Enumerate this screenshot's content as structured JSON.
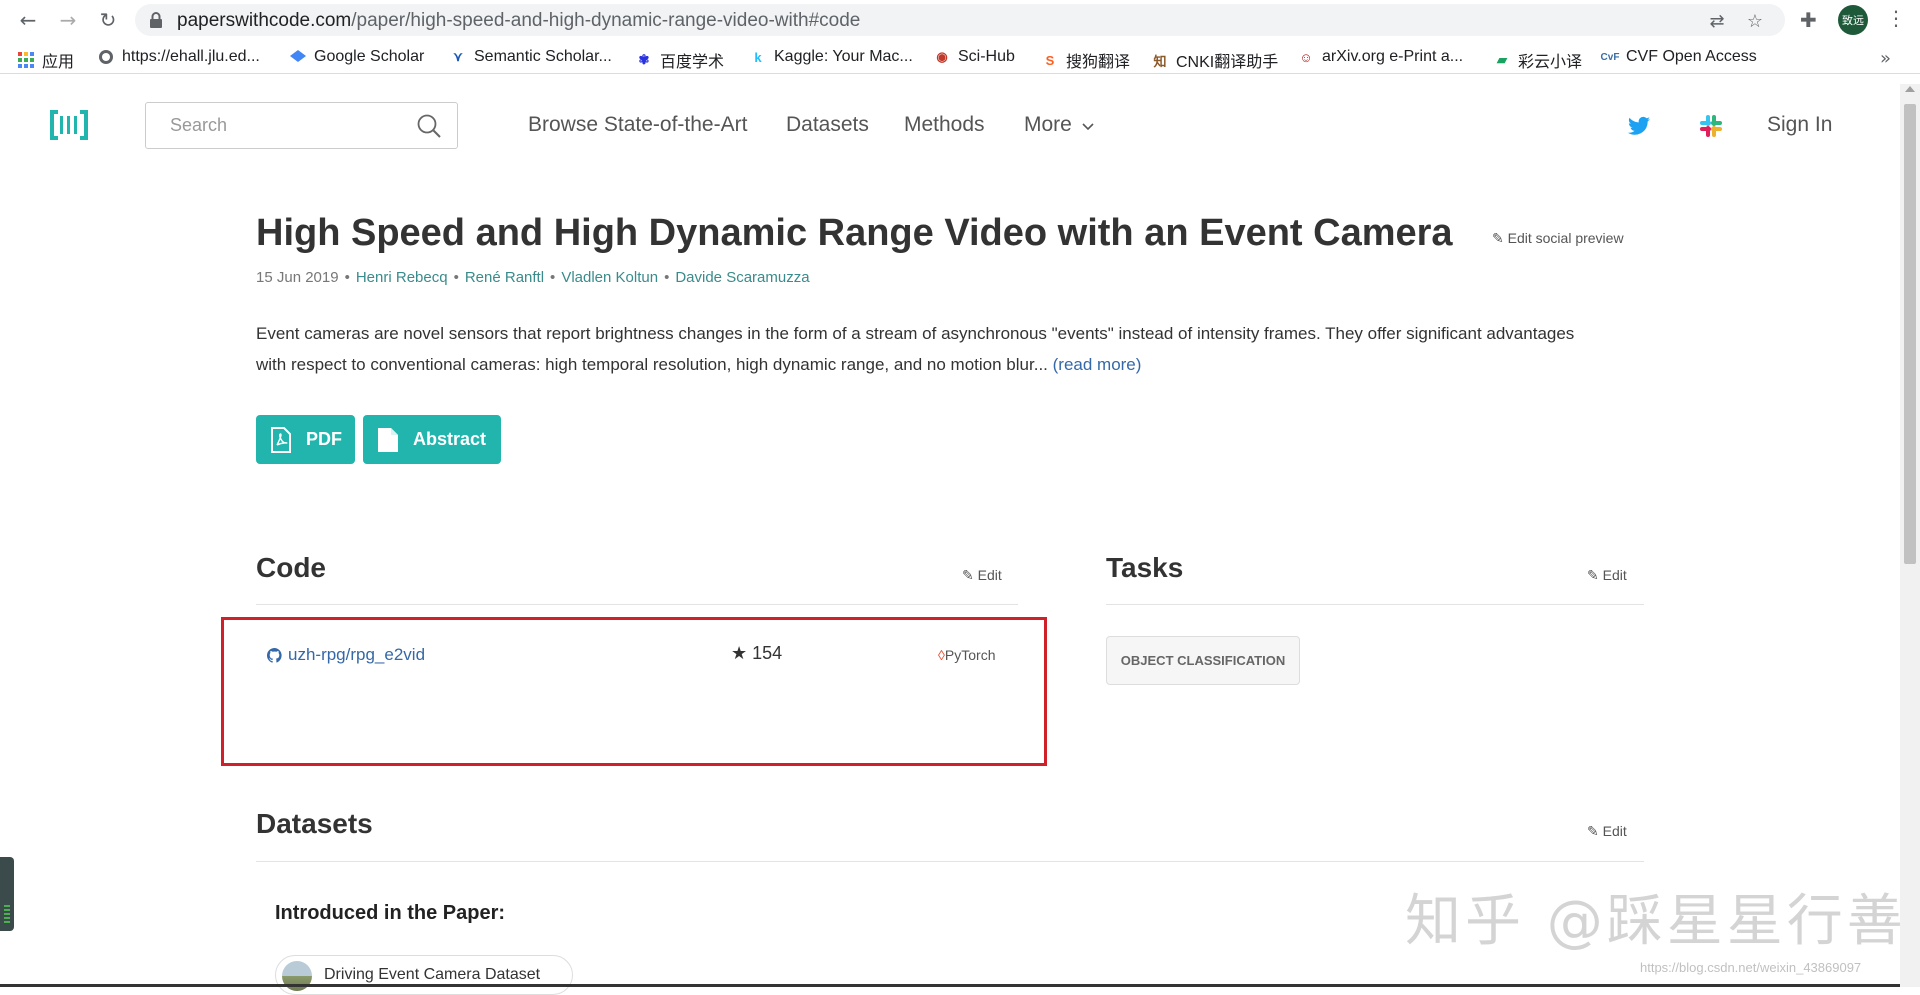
{
  "browser": {
    "url_host": "paperswithcode.com",
    "url_path": "/paper/high-speed-and-high-dynamic-range-video-with#code",
    "profile_label": "致远",
    "bookmarks": [
      {
        "label": "应用",
        "icon": "apps-grid-icon"
      },
      {
        "label": "https://ehall.jlu.ed...",
        "icon": "globe-icon"
      },
      {
        "label": "Google Scholar",
        "icon": "google-scholar-icon"
      },
      {
        "label": "Semantic Scholar...",
        "icon": "semantic-scholar-icon"
      },
      {
        "label": "百度学术",
        "icon": "baidu-icon"
      },
      {
        "label": "Kaggle: Your Mac...",
        "icon": "kaggle-icon"
      },
      {
        "label": "Sci-Hub",
        "icon": "scihub-icon"
      },
      {
        "label": "搜狗翻译",
        "icon": "sogou-icon"
      },
      {
        "label": "CNKI翻译助手",
        "icon": "cnki-icon"
      },
      {
        "label": "arXiv.org e-Print a...",
        "icon": "arxiv-icon"
      },
      {
        "label": "彩云小译",
        "icon": "caiyun-icon"
      },
      {
        "label": "CVF Open Access",
        "icon": "cvf-icon"
      }
    ],
    "more_bookmarks": "»"
  },
  "site": {
    "search_placeholder": "Search",
    "nav": [
      "Browse State-of-the-Art",
      "Datasets",
      "Methods",
      "More"
    ],
    "sign_in": "Sign In",
    "brand_color": "#21b5ad"
  },
  "paper": {
    "title": "High Speed and High Dynamic Range Video with an Event Camera",
    "edit_social": "Edit social preview",
    "date": "15 Jun 2019",
    "authors": [
      "Henri Rebecq",
      "René Ranftl",
      "Vladlen Koltun",
      "Davide Scaramuzza"
    ],
    "abstract_line1": "Event cameras are novel sensors that report brightness changes in the form of a stream of asynchronous \"events\" instead of intensity frames. They offer significant advantages",
    "abstract_line2": "with respect to conventional cameras: high temporal resolution, high dynamic range, and no motion blur...",
    "read_more": "(read more)",
    "pdf_label": "PDF",
    "abstract_label": "Abstract"
  },
  "code": {
    "heading": "Code",
    "edit": "Edit",
    "repo": "uzh-rpg/rpg_e2vid",
    "stars": "★ 154",
    "framework": "PyTorch",
    "highlight_color": "#d0202a"
  },
  "tasks": {
    "heading": "Tasks",
    "edit": "Edit",
    "items": [
      "OBJECT CLASSIFICATION"
    ]
  },
  "datasets": {
    "heading": "Datasets",
    "edit": "Edit",
    "introduced_heading": "Introduced in the Paper:",
    "items": [
      "Driving Event Camera Dataset"
    ]
  },
  "overlay": {
    "watermark": "知乎 @踩星星行善",
    "csdn": "https://blog.csdn.net/weixin_43869097"
  }
}
